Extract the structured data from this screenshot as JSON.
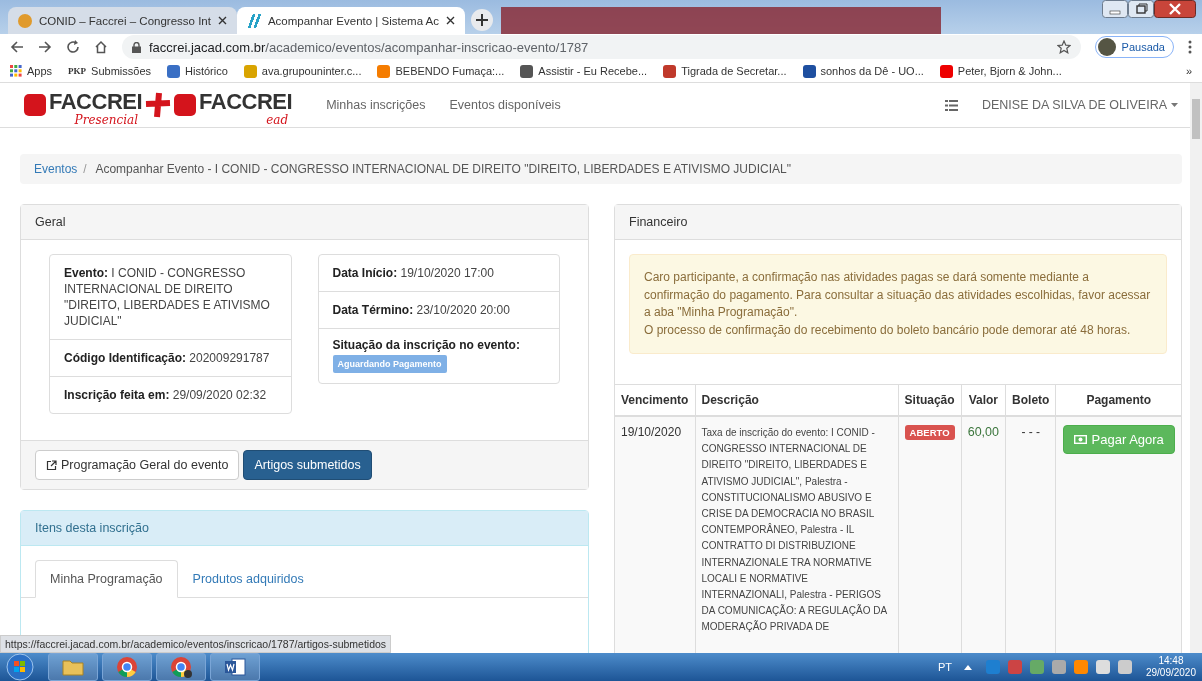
{
  "browser": {
    "tabs": [
      {
        "title": "CONID – Faccrei – Congresso Int",
        "selected": false
      },
      {
        "title": "Acompanhar Evento | Sistema Ac",
        "selected": true
      }
    ],
    "url_host": "faccrei.jacad.com.br",
    "url_path": "/academico/eventos/acompanhar-inscricao-evento/1787",
    "profile": "Pausada",
    "bookmarks": [
      {
        "label": "Apps",
        "kind": "apps"
      },
      {
        "label": "Submissões",
        "kind": "pkp",
        "icon_text": "PKP"
      },
      {
        "label": "Histórico",
        "kind": "history"
      },
      {
        "label": "ava.grupouninter.c...",
        "kind": "ava"
      },
      {
        "label": "BEBENDO Fumaça:...",
        "kind": "blogger"
      },
      {
        "label": "Assistir - Eu Recebe...",
        "kind": "tv"
      },
      {
        "label": "Tigrada de Secretar...",
        "kind": "tiger"
      },
      {
        "label": "sonhos da Dê - UO...",
        "kind": "uol"
      },
      {
        "label": "Peter, Bjorn & John...",
        "kind": "youtube"
      }
    ],
    "more": "»"
  },
  "navbar": {
    "logo": {
      "brand_1": "FACCREI",
      "script_1": "Presencial",
      "brand_2": "FACCREI",
      "script_2": "ead"
    },
    "links": [
      "Minhas inscrições",
      "Eventos disponíveis"
    ],
    "user": "DENISE DA SILVA DE OLIVEIRA"
  },
  "breadcrumb": {
    "separator": "/",
    "items": [
      "Eventos",
      "Acompanhar Evento - I CONID - CONGRESSO INTERNACIONAL DE DIREITO \"DIREITO, LIBERDADES E ATIVISMO JUDICIAL\""
    ]
  },
  "geral": {
    "title": "Geral",
    "left": [
      "**Evento:** I CONID - CONGRESSO INTERNACIONAL DE DIREITO \"DIREITO, LIBERDADES E ATIVISMO JUDICIAL\"",
      "**Código Identificação:** 202009291787",
      "**Inscrição feita em:** 29/09/2020 02:32"
    ],
    "right": [
      "**Data Início:** 19/10/2020 17:00",
      "**Data Término:** 23/10/2020 20:00"
    ],
    "status_label": "Situação da inscrição no evento:",
    "status_badge": "Aguardando Pagamento",
    "buttons": [
      {
        "label": "Programação Geral do evento",
        "kind": "default"
      },
      {
        "label": "Artigos submetidos",
        "kind": "primary"
      }
    ]
  },
  "itens": {
    "title": "Itens desta inscrição",
    "tabs": [
      {
        "label": "Minha Programação",
        "selected": true
      },
      {
        "label": "Produtos adquiridos",
        "selected": false
      }
    ]
  },
  "financeiro": {
    "title": "Financeiro",
    "alert": [
      "Caro participante, a confirmação nas atividades pagas se dará somente mediante a confirmação do pagamento. Para consultar a situação das atividades escolhidas, favor acessar a aba \"Minha Programação\".",
      "O processo de confirmação do recebimento do boleto bancário pode demorar até 48 horas."
    ],
    "columns": [
      "Vencimento",
      "Descrição",
      "Situação",
      "Valor",
      "Boleto",
      "Pagamento"
    ],
    "rows": [
      {
        "vencimento": "19/10/2020",
        "descricao": "Taxa de inscrição do evento: I CONID - CONGRESSO INTERNACIONAL DE DIREITO \"DIREITO, LIBERDADES E ATIVISMO JUDICIAL\", Palestra - CONSTITUCIONALISMO ABUSIVO E CRISE DA DEMOCRACIA NO BRASIL CONTEMPORÂNEO, Palestra - IL CONTRATTO DI DISTRIBUZIONE INTERNAZIONALE TRA NORMATIVE LOCALI E NORMATIVE INTERNAZIONALI, Palestra - PERIGOS DA COMUNICAÇÃO: A REGULAÇÃO DA MODERAÇÃO PRIVADA DE",
        "situacao": "ABERTO",
        "valor": "60,00",
        "boleto": "- - -",
        "pagamento": "Pagar Agora"
      }
    ]
  },
  "status_url": "https://faccrei.jacad.com.br/academico/eventos/inscricao/1787/artigos-submetidos",
  "taskbar": {
    "language": "PT",
    "time": "14:48",
    "date": "29/09/2020"
  }
}
